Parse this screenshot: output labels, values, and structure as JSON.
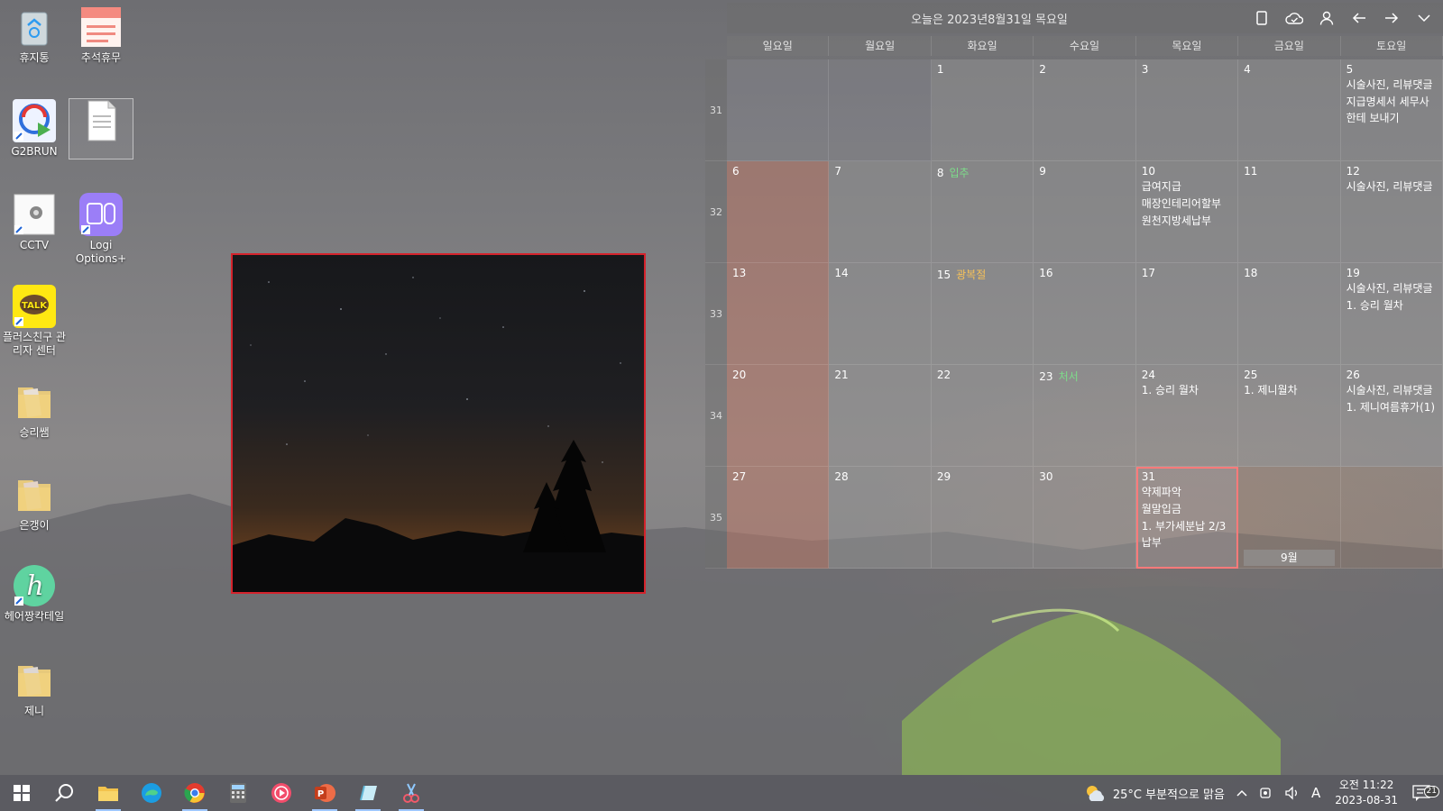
{
  "desktop_icons": [
    {
      "name": "recycle-bin",
      "label": "휴지통"
    },
    {
      "name": "chuseok-file",
      "label": "추석휴무"
    },
    {
      "name": "g2brun",
      "label": "G2BRUN"
    },
    {
      "name": "blank-document",
      "label": ""
    },
    {
      "name": "cctv",
      "label": "CCTV"
    },
    {
      "name": "logi-options",
      "label": "Logi Options+"
    },
    {
      "name": "kakao-plus",
      "label": "플러스친구 관리자 센터"
    },
    {
      "name": "folder-seungri",
      "label": "승리쌤"
    },
    {
      "name": "folder-eungaengi",
      "label": "은갱이"
    },
    {
      "name": "hair-cocktail",
      "label": "헤어짱칵테일"
    },
    {
      "name": "folder-jeni",
      "label": "제니"
    }
  ],
  "calendar": {
    "title": "오늘은 2023년8월31일 목요일",
    "weekdays": [
      "일요일",
      "월요일",
      "화요일",
      "수요일",
      "목요일",
      "금요일",
      "토요일"
    ],
    "week_numbers": [
      "31",
      "32",
      "33",
      "34",
      "35"
    ],
    "weeks": [
      [
        {
          "day": "",
          "type": "empty"
        },
        {
          "day": "",
          "type": "empty"
        },
        {
          "day": "1"
        },
        {
          "day": "2"
        },
        {
          "day": "3"
        },
        {
          "day": "4"
        },
        {
          "day": "5",
          "events": [
            "시술사진, 리뷰댓글",
            "지급명세서 세무사한테 보내기"
          ]
        }
      ],
      [
        {
          "day": "6",
          "type": "sun"
        },
        {
          "day": "7"
        },
        {
          "day": "8",
          "holiday": "입추",
          "holiday_color": "#7ddc8a"
        },
        {
          "day": "9"
        },
        {
          "day": "10",
          "events": [
            "급여지급",
            "매장인테리어할부",
            "원천지방세납부"
          ]
        },
        {
          "day": "11"
        },
        {
          "day": "12",
          "events": [
            "시술사진, 리뷰댓글"
          ]
        }
      ],
      [
        {
          "day": "13",
          "type": "sun"
        },
        {
          "day": "14"
        },
        {
          "day": "15",
          "holiday": "광복절",
          "holiday_color": "#f5c15a"
        },
        {
          "day": "16"
        },
        {
          "day": "17"
        },
        {
          "day": "18"
        },
        {
          "day": "19",
          "events": [
            "시술사진, 리뷰댓글",
            "1. 승리 월차"
          ]
        }
      ],
      [
        {
          "day": "20",
          "type": "sun"
        },
        {
          "day": "21"
        },
        {
          "day": "22"
        },
        {
          "day": "23",
          "holiday": "처서",
          "holiday_color": "#7ddc8a"
        },
        {
          "day": "24",
          "events": [
            "1. 승리 월차"
          ]
        },
        {
          "day": "25",
          "events": [
            "1. 제니월차"
          ]
        },
        {
          "day": "26",
          "events": [
            "시술사진, 리뷰댓글",
            "1. 제니여름휴가(1)"
          ]
        }
      ],
      [
        {
          "day": "27",
          "type": "sun"
        },
        {
          "day": "28"
        },
        {
          "day": "29"
        },
        {
          "day": "30"
        },
        {
          "day": "31",
          "type": "today",
          "events": [
            "약제파악",
            "월말입금",
            "1. 부가세분납 2/3납부"
          ]
        },
        {
          "day": "",
          "type": "next",
          "label": "9월"
        },
        {
          "day": "",
          "type": "next"
        }
      ]
    ],
    "toolbar_icons": [
      "phone-icon",
      "cloud-check-icon",
      "user-icon",
      "arrow-left-icon",
      "arrow-right-icon",
      "chevron-down-icon"
    ]
  },
  "taskbar": {
    "apps": [
      "start-button",
      "search-button",
      "file-explorer",
      "edge-browser",
      "chrome-browser",
      "calculator",
      "media-player",
      "powerpoint",
      "notepad-app",
      "snipping-tool"
    ],
    "weather": "25°C  부분적으로 맑음",
    "ime": "A",
    "time": "오전 11:22",
    "date": "2023-08-31",
    "notifications": "21"
  }
}
